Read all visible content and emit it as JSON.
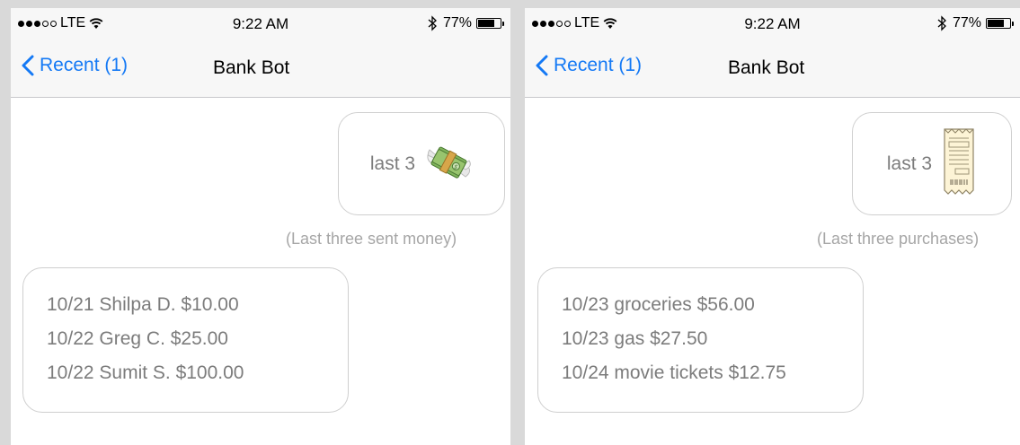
{
  "screens": [
    {
      "status": {
        "carrier": "LTE",
        "time": "9:22 AM",
        "battery": "77%",
        "battery_level": 0.77
      },
      "nav": {
        "back_label": "Recent (1)",
        "title": "Bank Bot"
      },
      "outgoing": {
        "text": "last 3",
        "emoji": "money-with-wings-icon"
      },
      "caption": "(Last three sent money)",
      "incoming": {
        "lines": [
          "10/21 Shilpa D. $10.00",
          "10/22 Greg C. $25.00",
          "10/22 Sumit S. $100.00"
        ]
      }
    },
    {
      "status": {
        "carrier": "LTE",
        "time": "9:22 AM",
        "battery": "77%",
        "battery_level": 0.77
      },
      "nav": {
        "back_label": "Recent (1)",
        "title": "Bank Bot"
      },
      "outgoing": {
        "text": "last 3",
        "emoji": "receipt-icon"
      },
      "caption": "(Last three purchases)",
      "incoming": {
        "lines": [
          "10/23 groceries $56.00",
          "10/23 gas $27.50",
          "10/24 movie tickets $12.75"
        ]
      }
    }
  ],
  "colors": {
    "ios_blue": "#1479f5",
    "bubble_border": "#cfcfcf",
    "bubble_text": "#7c7c7c",
    "caption": "#a6a6a6"
  }
}
